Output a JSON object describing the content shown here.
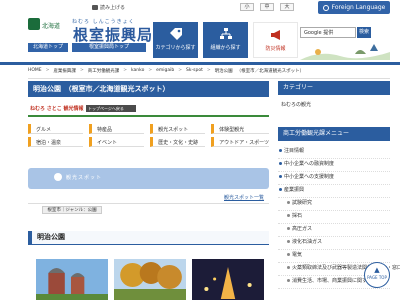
{
  "topbar": {
    "read_aloud": "読み上げる",
    "font_sizes": [
      "小",
      "中",
      "大"
    ],
    "language": "Foreign Language"
  },
  "header": {
    "prefecture": "北海道",
    "ruby": "ねむろ しんこうきょく",
    "title": "根室振興局",
    "pref_top": "北海道トップ",
    "bureau_top": "根室振興局トップ",
    "nav": {
      "category": "カテゴリから探す",
      "organization": "組織から探す",
      "disaster": "防災情報"
    },
    "search_placeholder": "Google 提供",
    "search_button": "検索"
  },
  "breadcrumb": [
    "HOME",
    "産業振興課",
    "商工労働観光課",
    "kanko",
    "emigaib",
    "Sk-spot",
    "明治公園",
    "（根室市／北海道観光スポット）"
  ],
  "page": {
    "title": "明治公園　（根室市／北海道観光スポット）",
    "mini_guide": "ねむろ さとこ 観光情報",
    "guide_tab": "トップページへ戻る",
    "categories": [
      "グルメ",
      "特産品",
      "観光スポット",
      "体験型観光",
      "宿泊・温泉",
      "イベント",
      "歴史・文化・史跡",
      "アウトドア・スポーツ"
    ],
    "banner": "観光スポット",
    "more_link": "観光スポット一覧",
    "genre": "根室市｜ジャンル：公園",
    "section_title": "明治公園"
  },
  "sidebar": {
    "category_heading": "カテゴリー",
    "category_item": "ねむろの観光",
    "menu_heading": "商工労働観光課メニュー",
    "items": [
      {
        "label": "注目情報",
        "sub": false
      },
      {
        "label": "中小企業への融資制度",
        "sub": false
      },
      {
        "label": "中小企業への支援制度",
        "sub": false
      },
      {
        "label": "産業振興",
        "sub": false
      },
      {
        "label": "試験研究",
        "sub": true
      },
      {
        "label": "採石",
        "sub": true
      },
      {
        "label": "高圧ガス",
        "sub": true
      },
      {
        "label": "液化石油ガス",
        "sub": true
      },
      {
        "label": "電気",
        "sub": true
      },
      {
        "label": "火薬類取締法及び武器等製造法関係（法令・窓口）",
        "sub": true
      },
      {
        "label": "消費生活、市場、商業振興に関すること",
        "sub": true
      }
    ]
  },
  "pagetop": "PAGE TOP"
}
